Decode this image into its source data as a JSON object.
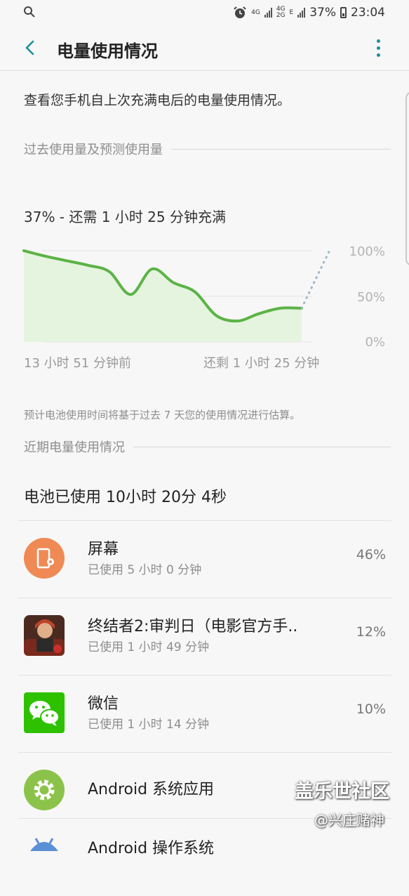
{
  "status_bar": {
    "network_a": "4G",
    "network_b": "4G",
    "network_b2": "2G",
    "network_c": "E",
    "battery": "37%",
    "time": "23:04"
  },
  "header": {
    "title": "电量使用情况"
  },
  "intro": "查看您手机自上次充满电后的电量使用情况。",
  "past_section": {
    "label": "过去使用量及预测使用量"
  },
  "estimate_text": "37% - 还需 1 小时 25 分钟充满",
  "chart_data": {
    "type": "area",
    "x_labels": [
      "13 小时 51 分钟前",
      "还剩 1 小时 25 分钟"
    ],
    "y_ticks": [
      "100%",
      "50%",
      "0%"
    ],
    "ylim": [
      0,
      100
    ],
    "grid": true,
    "x": [
      0,
      1,
      2,
      3,
      4,
      5,
      6,
      7,
      8,
      9,
      10,
      11,
      12,
      13
    ],
    "values": [
      100,
      94,
      89,
      84,
      77,
      52,
      80,
      65,
      55,
      29,
      23,
      31,
      37,
      37
    ],
    "projected": {
      "x": [
        13,
        14.3
      ],
      "values": [
        37,
        100
      ]
    },
    "colors": {
      "line": "#5cb346",
      "fill": "#e5f4df",
      "projection": "#9db7c9"
    }
  },
  "note": "预计电池使用时间将基于过去 7 天您的使用情况进行估算。",
  "recent_section": {
    "label": "近期电量使用情况"
  },
  "battery_used": "电池已使用 10小时 20分 4秒",
  "apps": [
    {
      "name": "屏幕",
      "usage": "已使用 5 小时 0 分钟",
      "percent": "46%",
      "icon": "screen-settings-icon"
    },
    {
      "name": "终结者2:审判日（电影官方手..",
      "usage": "已使用 1 小时 49 分钟",
      "percent": "12%",
      "icon": "terminator-game-icon"
    },
    {
      "name": "微信",
      "usage": "已使用 1 小时 14 分钟",
      "percent": "10%",
      "icon": "wechat-icon"
    },
    {
      "name": "Android 系统应用",
      "usage": "",
      "percent": "",
      "icon": "android-gear-icon"
    },
    {
      "name": "Android 操作系统",
      "usage": "",
      "percent": "",
      "icon": "android-robot-icon"
    }
  ],
  "watermark": {
    "line1": "盖乐世社区",
    "line2": "@兴庄赌神"
  }
}
